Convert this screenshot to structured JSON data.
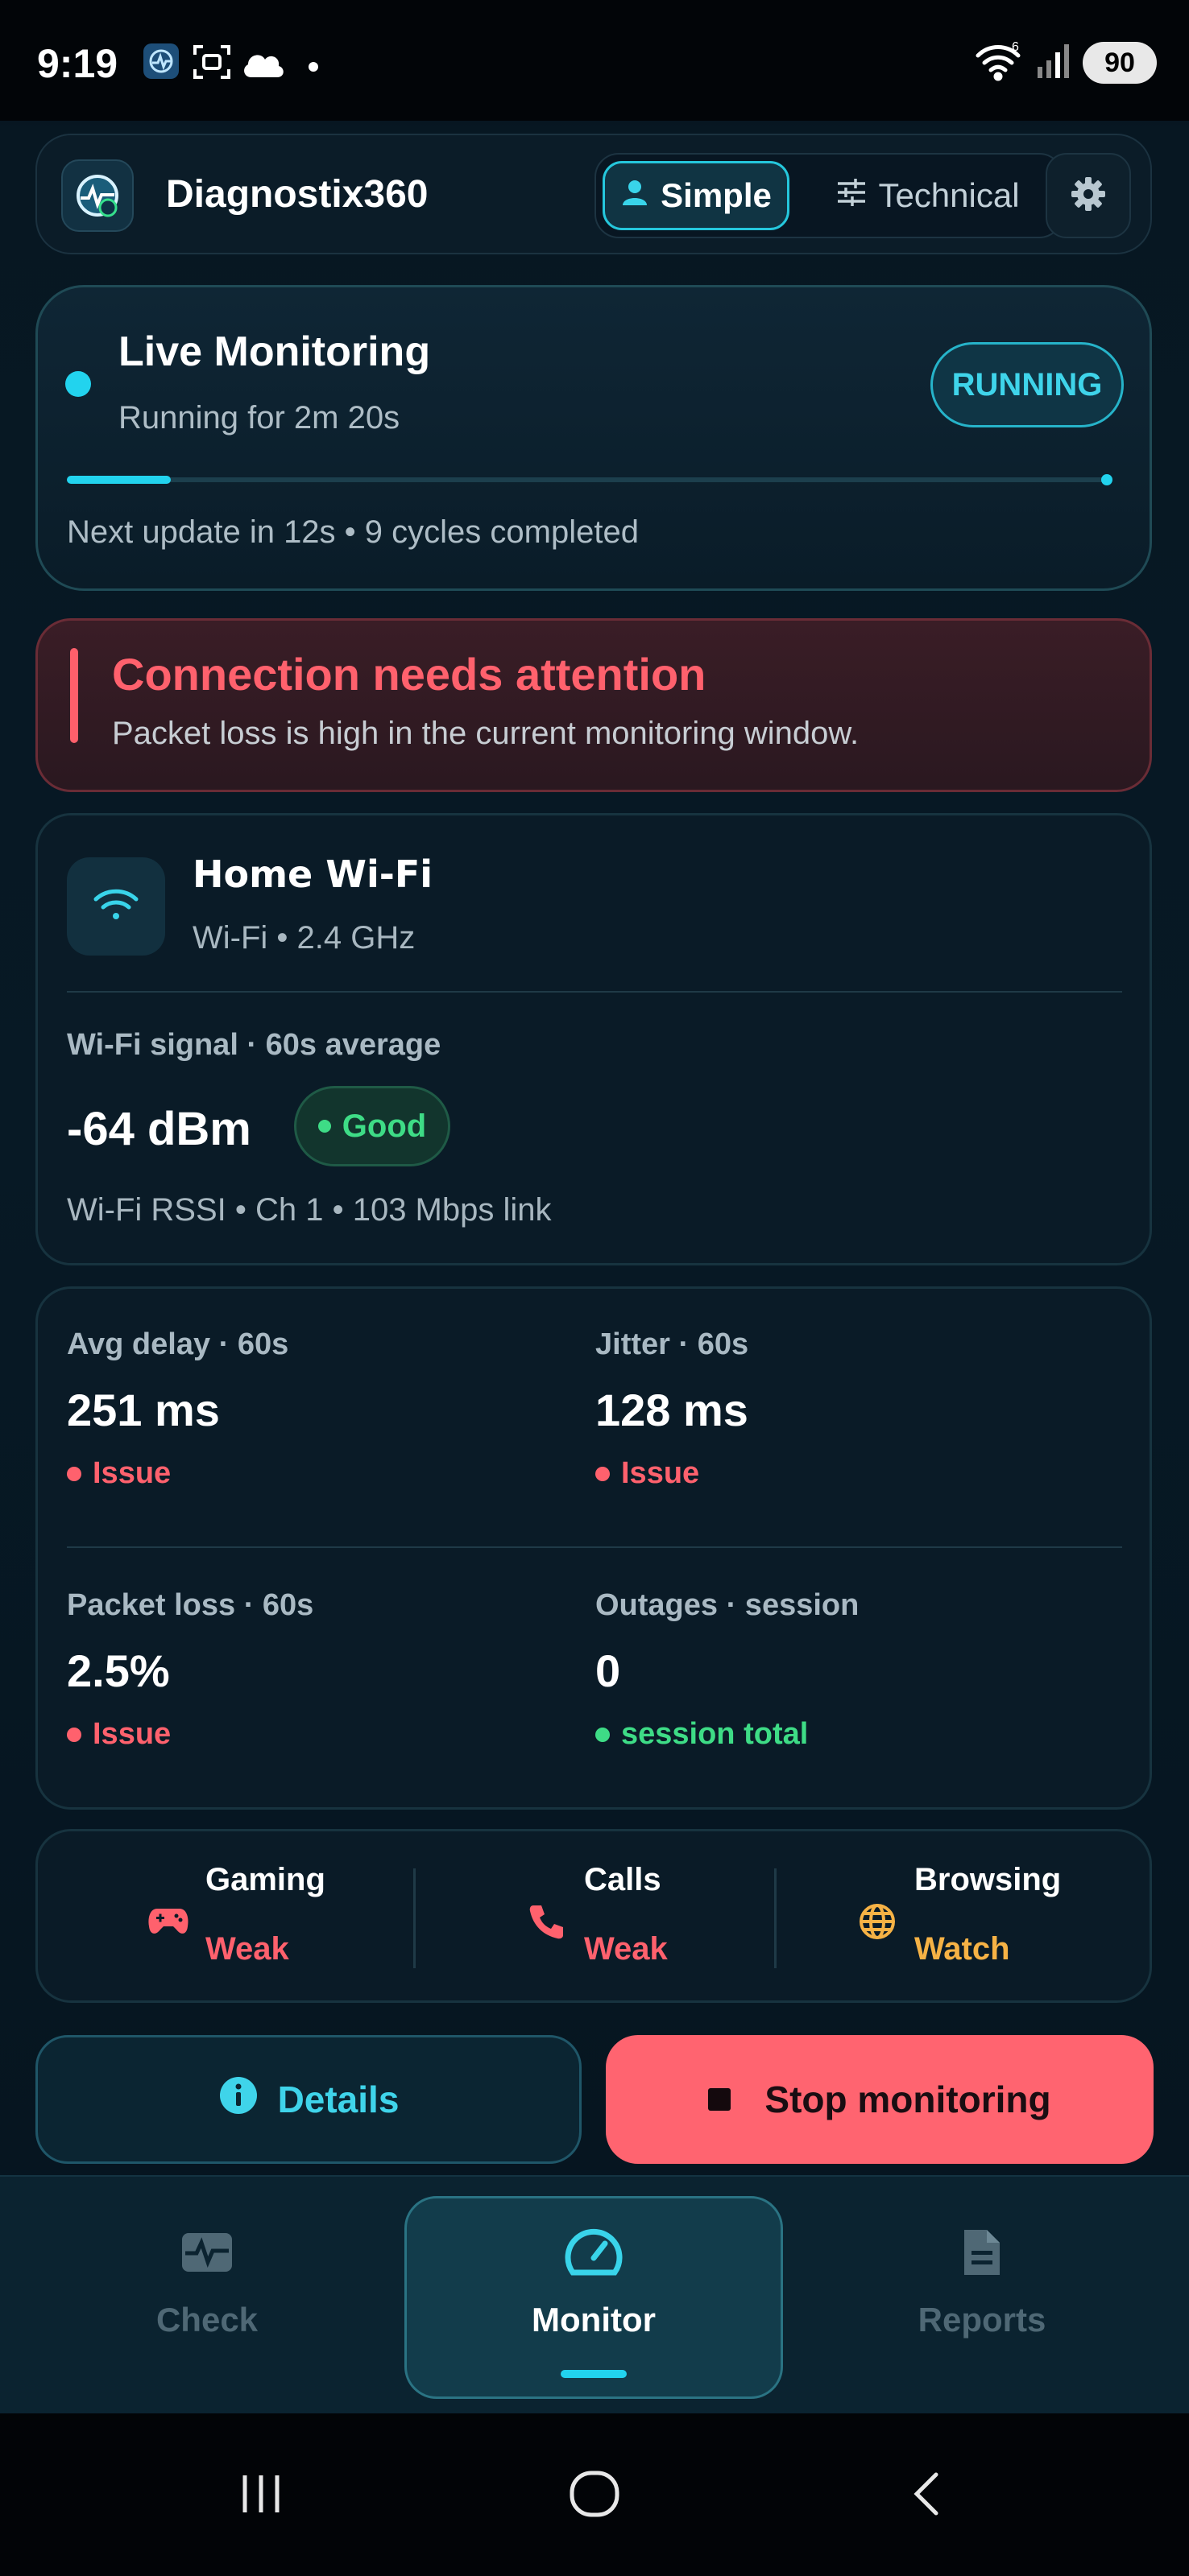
{
  "status_bar": {
    "time": "9:19",
    "battery": "90",
    "network_badge": "6"
  },
  "header": {
    "app_title": "Diagnostix360",
    "modes": {
      "simple": "Simple",
      "technical": "Technical"
    },
    "selected_mode": "Simple"
  },
  "live": {
    "title": "Live Monitoring",
    "subtitle": "Running for 2m 20s",
    "badge": "RUNNING",
    "progress": 0.1,
    "footer": "Next update in 12s • 9 cycles completed"
  },
  "alert": {
    "title": "Connection needs attention",
    "text": "Packet loss is high in the current monitoring window."
  },
  "network": {
    "name": "Home Wi-Fi",
    "meta": "Wi-Fi • 2.4 GHz",
    "signal_label": "Wi-Fi signal · 60s average",
    "signal_value": "-64 dBm",
    "signal_badge": "Good",
    "signal_meta": "Wi-Fi RSSI • Ch 1 • 103 Mbps link"
  },
  "metrics": [
    {
      "label": "Avg delay · 60s",
      "value": "251 ms",
      "status": "Issue"
    },
    {
      "label": "Jitter · 60s",
      "value": "128 ms",
      "status": "Issue"
    },
    {
      "label": "Packet loss · 60s",
      "value": "2.5%",
      "status": "Issue"
    },
    {
      "label": "Outages · session",
      "value": "0",
      "status": "session total"
    }
  ],
  "activities": [
    {
      "name": "Gaming",
      "status": "Weak",
      "icon": "gamepad-icon"
    },
    {
      "name": "Calls",
      "status": "Weak",
      "icon": "phone-icon"
    },
    {
      "name": "Browsing",
      "status": "Watch",
      "icon": "globe-icon"
    }
  ],
  "buttons": {
    "details": "Details",
    "stop": "Stop monitoring"
  },
  "nav": {
    "check": "Check",
    "monitor": "Monitor",
    "reports": "Reports",
    "active": "Monitor"
  },
  "colors": {
    "accent": "#22d3ee",
    "issue": "#ff616d",
    "good": "#3edc86",
    "watch": "#f6b245",
    "stop": "#ff6470"
  }
}
